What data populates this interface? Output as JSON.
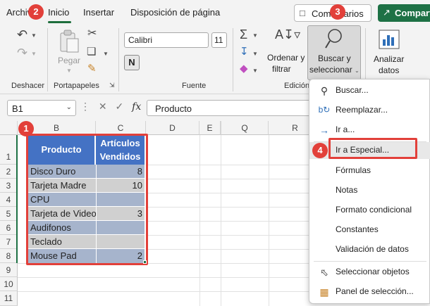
{
  "tabs": {
    "archivo": "Archivo",
    "inicio": "Inicio",
    "insertar": "Insertar",
    "disposicion": "Disposición de página"
  },
  "header_buttons": {
    "comentarios": "Comentarios",
    "compartir": "Compartir"
  },
  "ribbon": {
    "groups": {
      "deshacer": "Deshacer",
      "portapapeles": "Portapapeles",
      "fuente": "Fuente",
      "edicion": "Edición"
    },
    "pegar": "Pegar",
    "font_name": "Calibri",
    "font_size": "11",
    "bold": "N",
    "ordenar_1": "Ordenar y",
    "ordenar_2": "filtrar",
    "buscar_1": "Buscar y",
    "buscar_2": "seleccionar",
    "analizar_1": "Analizar",
    "analizar_2": "datos"
  },
  "formula_bar": {
    "name_box": "B1",
    "fx": "fx",
    "content": "Producto"
  },
  "columns": [
    "B",
    "C",
    "D",
    "E",
    "Q",
    "R"
  ],
  "rows": [
    "1",
    "2",
    "3",
    "4",
    "5",
    "6",
    "7",
    "8",
    "9",
    "10",
    "11"
  ],
  "table": {
    "header_producto": "Producto",
    "header_articulos_1": "Artículos",
    "header_articulos_2": "Vendidos",
    "rows": [
      {
        "producto": "Disco Duro",
        "cantidad": "8"
      },
      {
        "producto": "Tarjeta Madre",
        "cantidad": "10"
      },
      {
        "producto": "CPU",
        "cantidad": ""
      },
      {
        "producto": "Tarjeta de Video",
        "cantidad": "3"
      },
      {
        "producto": "Audifonos",
        "cantidad": ""
      },
      {
        "producto": "Teclado",
        "cantidad": ""
      },
      {
        "producto": "Mouse Pad",
        "cantidad": "2"
      }
    ]
  },
  "menu": {
    "items": [
      {
        "label": "Buscar...",
        "icon": "magnifier-icon"
      },
      {
        "label": "Reemplazar...",
        "icon": "replace-icon"
      },
      {
        "label": "Ir a...",
        "icon": "arrow-right-icon"
      },
      {
        "label": "Ir a Especial...",
        "icon": ""
      },
      {
        "label": "Fórmulas",
        "icon": ""
      },
      {
        "label": "Notas",
        "icon": ""
      },
      {
        "label": "Formato condicional",
        "icon": ""
      },
      {
        "label": "Constantes",
        "icon": ""
      },
      {
        "label": "Validación de datos",
        "icon": ""
      },
      {
        "label": "Seleccionar objetos",
        "icon": "pointer-icon"
      },
      {
        "label": "Panel de selección...",
        "icon": "selection-pane-icon"
      }
    ]
  },
  "steps": [
    "1",
    "2",
    "3",
    "4"
  ],
  "colors": {
    "accent_green": "#1e7145",
    "callout_red": "#e2403a",
    "table_header_blue": "#4472c4",
    "band_blue": "#a6b4cc",
    "band_gray": "#d0d0d0"
  }
}
